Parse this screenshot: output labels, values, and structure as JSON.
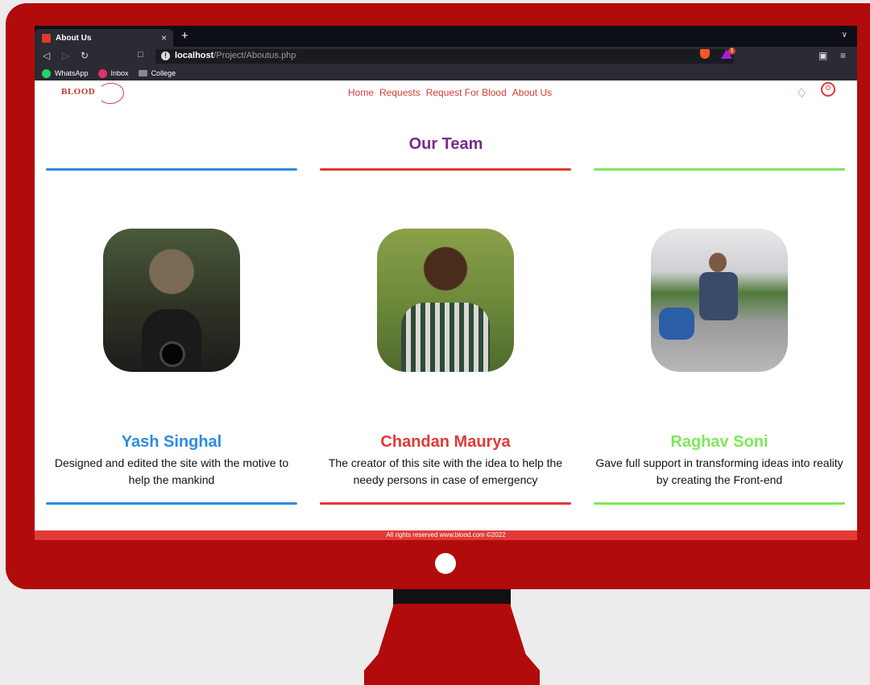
{
  "browser": {
    "tab_title": "About Us",
    "tab_close": "×",
    "new_tab": "+",
    "url_host": "localhost",
    "url_path": "/Project/Aboutus.php",
    "rewards_count": "3",
    "bookmarks": [
      {
        "label": "WhatsApp",
        "color": "#25d366"
      },
      {
        "label": "Inbox",
        "color": "#e1306c"
      },
      {
        "label": "College",
        "color": "#888888"
      }
    ]
  },
  "site": {
    "logo": "BLOOD",
    "nav": [
      "Home",
      "Requests",
      "Request For Blood",
      "About Us"
    ]
  },
  "team": {
    "title": "Our Team",
    "members": [
      {
        "name": "Yash Singhal",
        "color": "#2f8be3",
        "desc_1": "Designed and edited the site with the motive to",
        "desc_2": "help the mankind"
      },
      {
        "name": "Chandan Maurya",
        "color": "#e03a35",
        "desc_1": "The creator of this site with the idea to help the",
        "desc_2": "needy persons in case of emergency"
      },
      {
        "name": "Raghav Soni",
        "color": "#7ee85a",
        "desc_1": "Gave full support in transforming ideas into reality",
        "desc_2": "by creating the Front-end"
      }
    ]
  },
  "footer": {
    "text": "All rights reserved www.blood.com ©2022"
  }
}
